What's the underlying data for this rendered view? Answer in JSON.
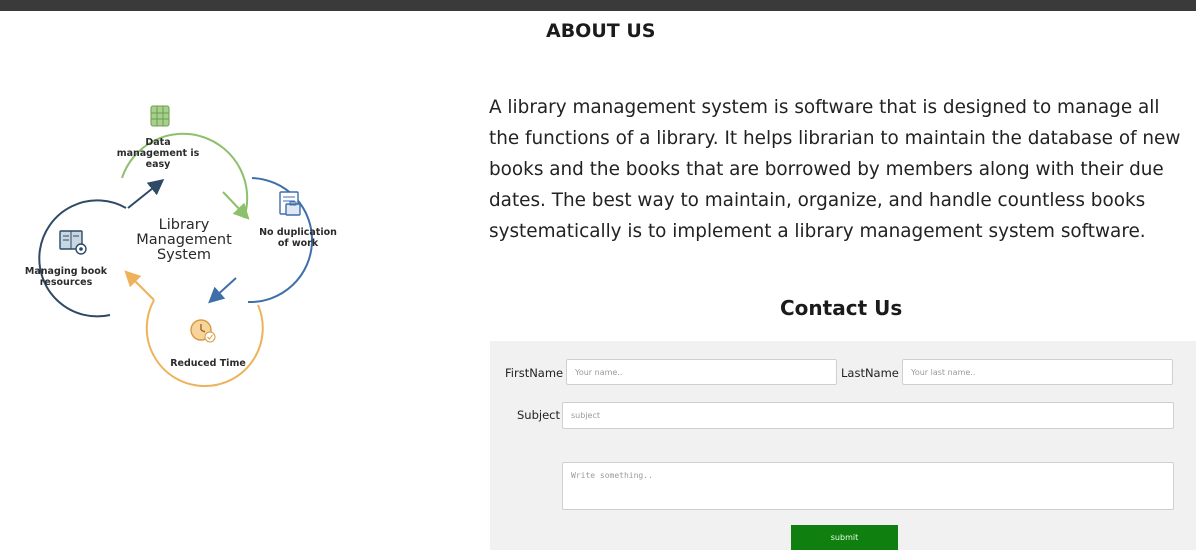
{
  "about": {
    "title": "ABOUT US",
    "paragraph": "A library management system is software that is designed to manage all the functions of a library. It helps librarian to maintain the database of new books and the books that are borrowed by members along with their due dates. The best way to maintain, organize, and handle countless books systematically is to implement a library management system software."
  },
  "diagram": {
    "center_label": "Library Management System",
    "nodes": [
      {
        "label": "Data management is easy",
        "icon": "database-icon",
        "color": "#8cc06b"
      },
      {
        "label": "No duplication of work",
        "icon": "document-briefcase-icon",
        "color": "#3f6fa8"
      },
      {
        "label": "Reduced Time",
        "icon": "clock-icon",
        "color": "#eeb35a"
      },
      {
        "label": "Managing book resources",
        "icon": "book-gear-icon",
        "color": "#2e4a66"
      }
    ]
  },
  "contact": {
    "title": "Contact Us",
    "firstname_label": "FirstName",
    "firstname_placeholder": "Your name..",
    "lastname_label": "LastName",
    "lastname_placeholder": "Your last name..",
    "subject_label": "Subject",
    "subject_placeholder": "subject",
    "message_placeholder": "Write something..",
    "submit_label": "submit",
    "submit_color": "#0f7f0f"
  }
}
